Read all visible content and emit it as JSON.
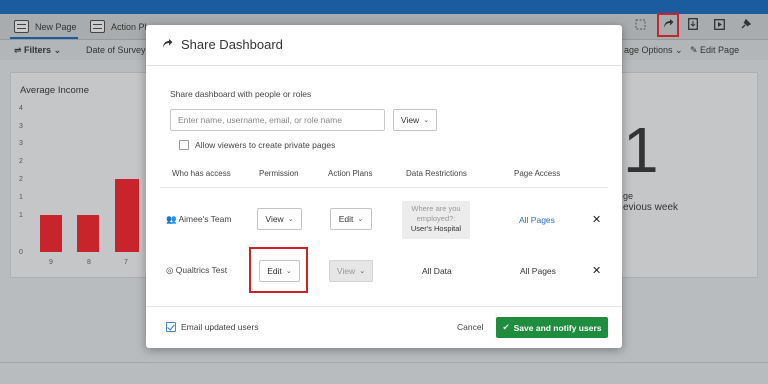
{
  "tabs": {
    "new_page": "New Page",
    "action_plans": "Action Pl"
  },
  "filters": {
    "label": "Filters",
    "date": "Date of Survey C",
    "page_options": "age Options",
    "edit_page": "Edit Page"
  },
  "left_panel": {
    "title": "Average Income",
    "y_ticks": [
      "4",
      "3",
      "3",
      "2",
      "2",
      "1",
      "1",
      "0"
    ],
    "x_ticks": [
      "9",
      "8",
      "7"
    ]
  },
  "right_panel": {
    "big_number": "1",
    "sub1": "ge",
    "sub2": "evious week"
  },
  "modal": {
    "title": "Share Dashboard",
    "share_label": "Share dashboard with people or roles",
    "input_placeholder": "Enter name, username, email, or role name",
    "view_select": "View",
    "allow_private": "Allow viewers to create private pages",
    "headers": {
      "who": "Who has access",
      "permission": "Permission",
      "action_plans": "Action Plans",
      "data_restrictions": "Data Restrictions",
      "page_access": "Page Access"
    },
    "rows": [
      {
        "name": "Aimee's Team",
        "permission": "View",
        "action_plans": "Edit",
        "restriction_q": "Where are you employed?:",
        "restriction_v": "User's Hospital",
        "page_access": "All Pages"
      },
      {
        "name": "Qualtrics Test",
        "permission": "Edit",
        "action_plans": "View",
        "restriction_v": "All Data",
        "page_access": "All Pages"
      }
    ],
    "email_updated": "Email updated users",
    "cancel": "Cancel",
    "save": "Save and notify users"
  },
  "colors": {
    "accent": "#1b5c9e",
    "save_green": "#1e8e3e",
    "highlight_red": "#c7242b",
    "bar_red": "#c7242b"
  }
}
